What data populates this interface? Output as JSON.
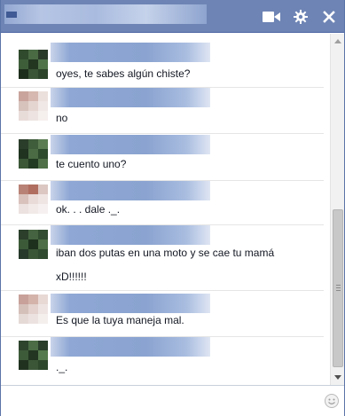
{
  "chat": {
    "icons": {
      "video": "video-camera-icon",
      "settings": "gear-icon",
      "close": "close-icon",
      "emoji": "smiley-icon"
    },
    "colors": {
      "titlebar": "#6d84b4",
      "name_blur": "#8ea7d4",
      "separator": "#e5e5e5"
    },
    "messages": [
      {
        "text": "oyes, te sabes algún chiste?",
        "sender": "friend"
      },
      {
        "text": "no",
        "sender": "me"
      },
      {
        "text": "te cuento uno?",
        "sender": "friend"
      },
      {
        "text": "ok. . . dale ._.",
        "sender": "me"
      },
      {
        "text": "iban dos putas en una moto y se cae tu mamá",
        "text2": "xD!!!!!!",
        "sender": "friend"
      },
      {
        "text": "Es que la tuya maneja mal.",
        "sender": "me"
      },
      {
        "text": "._.",
        "sender": "friend"
      }
    ],
    "composer": {
      "placeholder": ""
    }
  }
}
